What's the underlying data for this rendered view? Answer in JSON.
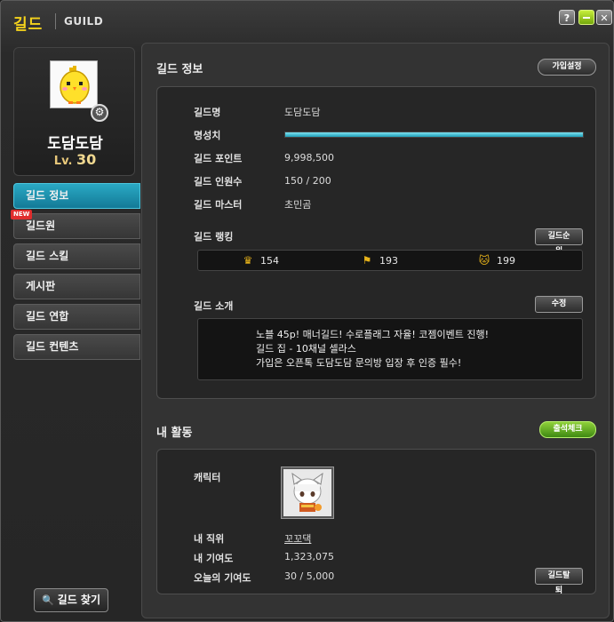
{
  "window": {
    "title_ko": "길드",
    "title_en": "GUILD",
    "help_label": "?",
    "close_label": "✕"
  },
  "profile": {
    "name": "도담도담",
    "level_prefix": "Lv.",
    "level": "30"
  },
  "nav": {
    "new_badge": "NEW",
    "items": [
      {
        "label": "길드 정보"
      },
      {
        "label": "길드원"
      },
      {
        "label": "길드 스킬"
      },
      {
        "label": "게시판"
      },
      {
        "label": "길드 연합"
      },
      {
        "label": "길드 컨텐츠"
      }
    ],
    "find_label": "길드 찾기"
  },
  "guild_info": {
    "section_title": "길드 정보",
    "join_settings_label": "가입설정",
    "name_label": "길드명",
    "name_value": "도담도담",
    "fame_label": "명성치",
    "fame_fill_fraction": 1.0,
    "points_label": "길드 포인트",
    "points_value": "9,998,500",
    "members_label": "길드 인원수",
    "members_value": "150 / 200",
    "master_label": "길드 마스터",
    "master_value": "초민곰",
    "ranking_label": "길드 랭킹",
    "ranking_button": "길드순위",
    "rankings": [
      {
        "icon": "crown-icon",
        "value": "154"
      },
      {
        "icon": "flag-icon",
        "value": "193"
      },
      {
        "icon": "cat-mask-icon",
        "value": "199"
      }
    ],
    "intro_label": "길드 소개",
    "edit_button": "수정",
    "intro_lines": [
      "노블 45p! 매너길드! 수로플래그 자율! 코젬이벤트 진행!",
      "길드 집 - 10채널 셀라스",
      "가입은 오픈톡 도담도담 문의방 입장 후 인증 필수!"
    ]
  },
  "activity": {
    "section_title": "내 활동",
    "attendance_button": "출석체크",
    "character_label": "캐릭터",
    "position_label": "내 직위",
    "position_value": "꼬꼬댁",
    "contribution_label": "내 기여도",
    "contribution_value": "1,323,075",
    "today_label": "오늘의 기여도",
    "today_value": "30 / 5,000",
    "leave_button": "길드탈퇴"
  },
  "colors": {
    "title_yellow": "#f4d21c",
    "active_tab": "#1f93b0",
    "fame_bar": "#3cc0d6",
    "attendance_green": "#6cb22a"
  }
}
